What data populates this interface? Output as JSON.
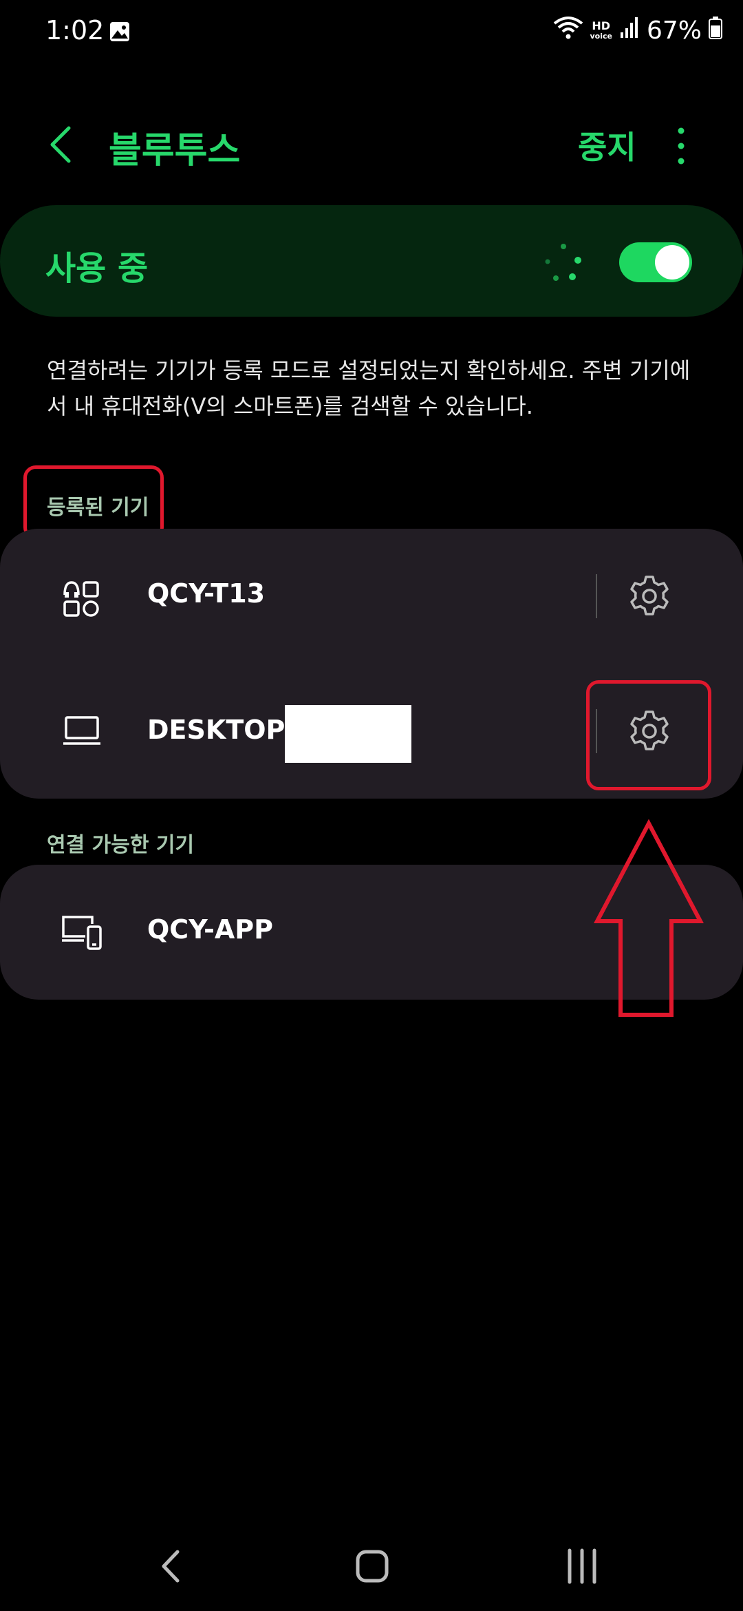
{
  "status_bar": {
    "time": "1:02",
    "hd_top": "HD",
    "hd_bottom": "voice",
    "battery": "67%"
  },
  "header": {
    "title": "블루투스",
    "stop_label": "중지"
  },
  "master": {
    "label": "사용 중",
    "enabled": true
  },
  "description": "연결하려는 기기가 등록 모드로 설정되었는지 확인하세요. 주변 기기에서 내 휴대전화(V의 스마트폰)를 검색할 수 있습니다.",
  "registered": {
    "header": "등록된 기기",
    "devices": [
      {
        "name": "QCY-T13",
        "icon": "earbuds-icon"
      },
      {
        "name": "DESKTOP-",
        "icon": "laptop-icon"
      }
    ]
  },
  "available": {
    "header": "연결 가능한 기기",
    "devices": [
      {
        "name": "QCY-APP",
        "icon": "devices-icon"
      }
    ]
  },
  "colors": {
    "accent": "#27d86b",
    "card": "#221d24",
    "annotation": "#e0182d"
  }
}
